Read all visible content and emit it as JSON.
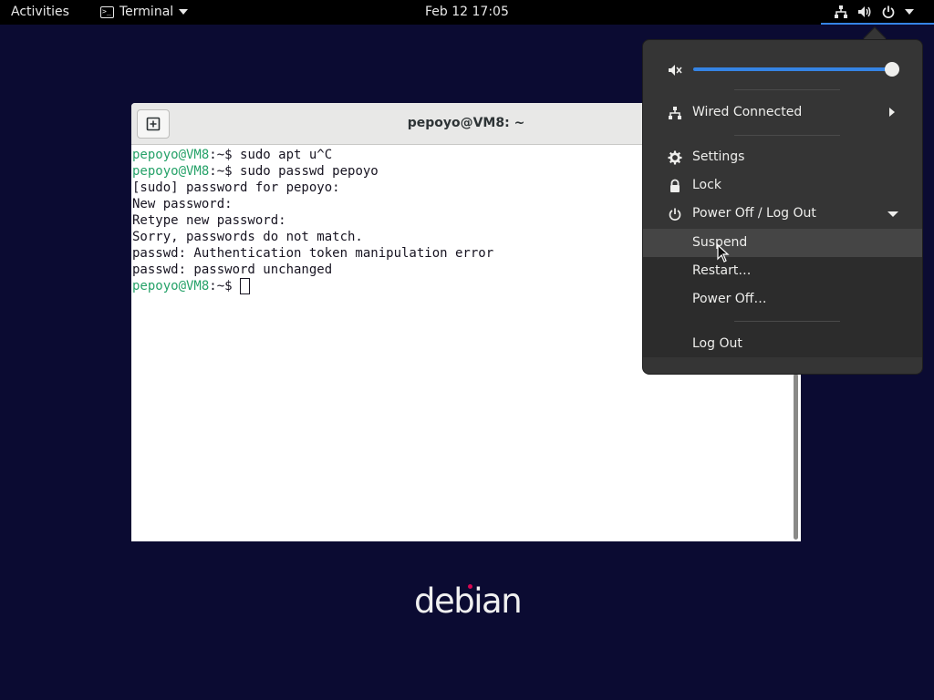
{
  "topbar": {
    "activities": "Activities",
    "app_name": "Terminal",
    "clock": "Feb 12  17:05"
  },
  "terminal": {
    "title": "pepoyo@VM8: ~",
    "lines": [
      {
        "prompt": "pepoyo@VM8",
        "rest": ":~$ sudo apt u^C"
      },
      {
        "prompt": "pepoyo@VM8",
        "rest": ":~$ sudo passwd pepoyo"
      },
      {
        "prompt": "",
        "rest": "[sudo] password for pepoyo:"
      },
      {
        "prompt": "",
        "rest": "New password:"
      },
      {
        "prompt": "",
        "rest": "Retype new password:"
      },
      {
        "prompt": "",
        "rest": "Sorry, passwords do not match."
      },
      {
        "prompt": "",
        "rest": "passwd: Authentication token manipulation error"
      },
      {
        "prompt": "",
        "rest": "passwd: password unchanged"
      },
      {
        "prompt": "pepoyo@VM8",
        "rest": ":~$ "
      }
    ]
  },
  "system_menu": {
    "volume_level": 1.0,
    "network_label": "Wired Connected",
    "settings_label": "Settings",
    "lock_label": "Lock",
    "power_label": "Power Off / Log Out",
    "suspend_label": "Suspend",
    "restart_label": "Restart…",
    "poweroff_label": "Power Off…",
    "logout_label": "Log Out"
  },
  "desktop": {
    "logo_text": "debian"
  },
  "colors": {
    "desktop_bg": "#0b0b32",
    "prompt_green": "#26a269",
    "accent_blue": "#3584e4",
    "menu_bg": "#353535"
  }
}
